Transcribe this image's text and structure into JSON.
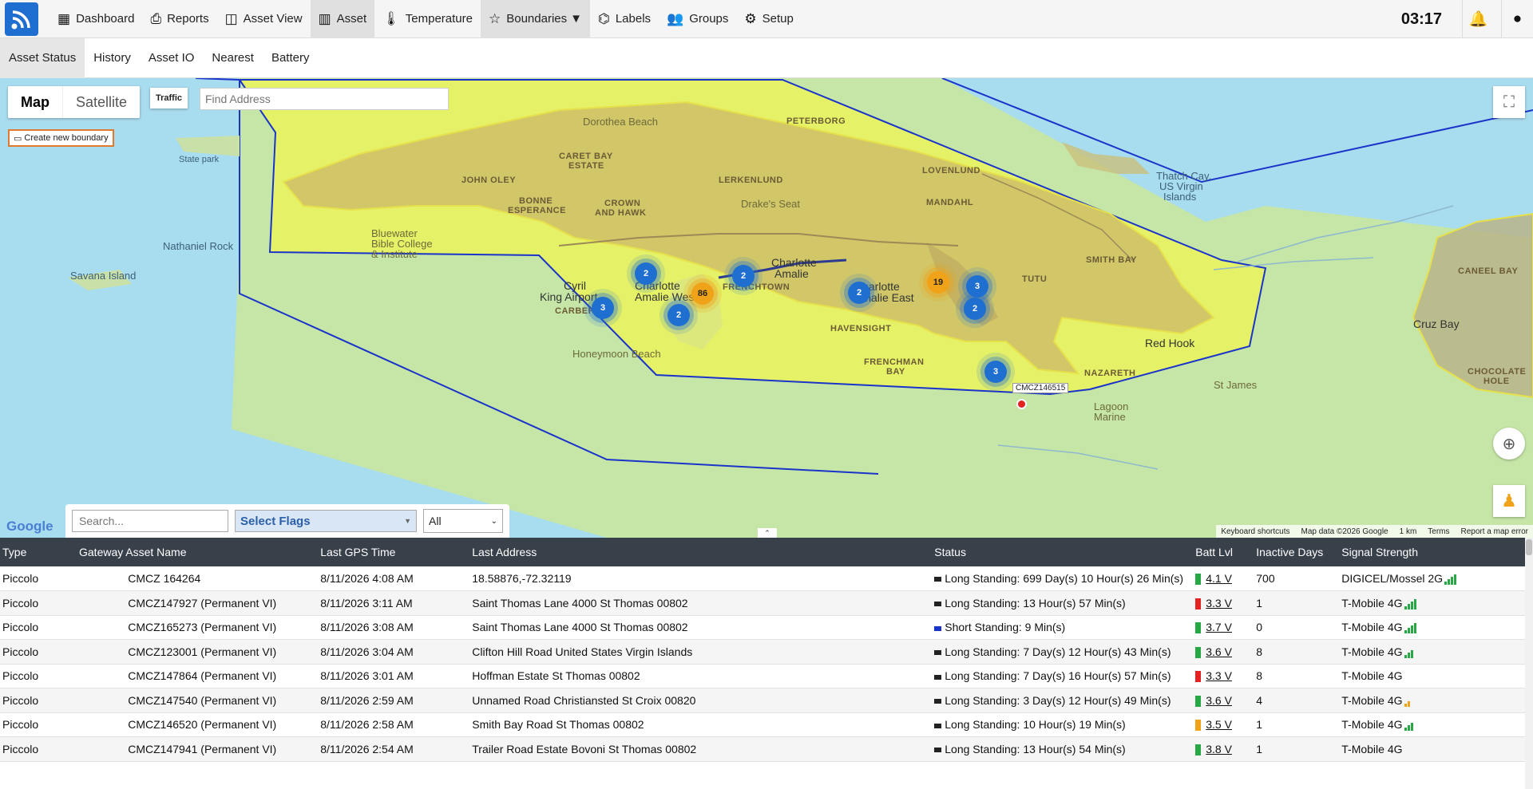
{
  "header": {
    "nav": [
      {
        "label": "Dashboard",
        "icon": "dashboard-icon"
      },
      {
        "label": "Reports",
        "icon": "printer-icon"
      },
      {
        "label": "Asset View",
        "icon": "map-icon"
      },
      {
        "label": "Asset",
        "icon": "barcode-icon"
      },
      {
        "label": "Temperature",
        "icon": "thermometer-icon"
      },
      {
        "label": "Boundaries",
        "icon": "star-icon"
      },
      {
        "label": "Labels",
        "icon": "tag-icon"
      },
      {
        "label": "Groups",
        "icon": "users-icon"
      },
      {
        "label": "Setup",
        "icon": "gear-icon"
      }
    ],
    "clock": "03:17"
  },
  "subnav": {
    "tabs": [
      "Asset Status",
      "History",
      "Asset IO",
      "Nearest",
      "Battery"
    ]
  },
  "map": {
    "type_map": "Map",
    "type_satellite": "Satellite",
    "traffic": "Traffic",
    "find_address_placeholder": "Find Address",
    "create_boundary": "Create new boundary",
    "labels": {
      "dorothea_beach": "Dorothea Beach",
      "peterborg": "PETERBORG",
      "caret_bay": "CARET BAY",
      "estate": "ESTATE",
      "john_oley": "JOHN OLEY",
      "lerkenlund": "LERKENLUND",
      "lovenlund": "LOVENLUND",
      "bonne": "BONNE",
      "esperance": "ESPERANCE",
      "crown": "CROWN",
      "and_hawk": "AND HAWK",
      "drakes_seat": "Drake's Seat",
      "mandahl": "MANDAHL",
      "thatch_cay": "Thatch Cay,",
      "us_virgin": "US Virgin",
      "islands": "Islands",
      "state_park": "State park",
      "nathaniel_rock": "Nathaniel Rock",
      "savana_island": "Savana Island",
      "bluewater": "Bluewater",
      "bible_college": "Bible College",
      "institute": "& Institute",
      "charlotte_amalie": "Charlotte",
      "amalie": "Amalie",
      "charlotte_east": "Charlotte",
      "amalie_east": "Amalie East",
      "cyril": "Cyril",
      "king_airport": "King Airport",
      "charlotte_amalie_west": "Charlotte",
      "amalie_west": "Amalie West",
      "frenchtown": "FRENCHTOWN",
      "havensight": "HAVENSIGHT",
      "smith_bay": "SMITH BAY",
      "tutu": "TUTU",
      "honeymoon_beach": "Honeymoon Beach",
      "frenchman": "FRENCHMAN",
      "bay": "BAY",
      "red_hook": "Red Hook",
      "nazareth": "NAZARETH",
      "james": "St James",
      "marine": "Marine",
      "lagoon": "Lagoon",
      "cruz_bay": "Cruz Bay",
      "caneel_bay": "CANEEL BAY",
      "chocolate_hole": "CHOCOLATE",
      "hole": "HOLE",
      "campbell": "CARBERG",
      "asset_tag": "CMCZ146515"
    },
    "clusters": [
      {
        "label": "2",
        "kind": "blue"
      },
      {
        "label": "86",
        "kind": "orange"
      },
      {
        "label": "2",
        "kind": "blue"
      },
      {
        "label": "3",
        "kind": "blue"
      },
      {
        "label": "2",
        "kind": "blue"
      },
      {
        "label": "2",
        "kind": "blue"
      },
      {
        "label": "19",
        "kind": "orange"
      },
      {
        "label": "3",
        "kind": "blue"
      },
      {
        "label": "2",
        "kind": "blue"
      },
      {
        "label": "3",
        "kind": "blue"
      }
    ],
    "google": "Google",
    "footer": {
      "shortcuts": "Keyboard shortcuts",
      "data": "Map data ©2026 Google",
      "scale": "1 km",
      "terms": "Terms",
      "report": "Report a map error"
    },
    "colors": {
      "water": "#a8dcef",
      "boundary": "#e8f25a",
      "land": "#c9c07a",
      "outline": "#1a33c9",
      "cluster_blue": "#1f6fd1",
      "cluster_orange": "#f0a318"
    }
  },
  "filters": {
    "search_placeholder": "Search...",
    "flags": "Select Flags",
    "all": "All"
  },
  "table": {
    "headers": [
      "Type",
      "Gateway",
      "Asset Name",
      "Last GPS Time",
      "Last Address",
      "Status",
      "Batt Lvl",
      "Inactive Days",
      "Signal Strength"
    ],
    "rows": [
      {
        "type": "Piccolo",
        "gateway": "",
        "name": "CMCZ 164264",
        "time": "8/11/2026 4:08 AM",
        "address": "18.58876,-72.32119",
        "status": "Long Standing: 699 Day(s) 10 Hour(s) 26 Min(s)",
        "status_color": "#222222",
        "batt": "4.1 V",
        "batt_color": "#27a844",
        "inactive": "700",
        "signal": "DIGICEL/Mossel 2G",
        "bars": 4,
        "bars_color": "#27a844"
      },
      {
        "type": "Piccolo",
        "gateway": "",
        "name": "CMCZ147927 (Permanent VI)",
        "time": "8/11/2026 3:11 AM",
        "address": "Saint Thomas Lane 4000 St Thomas 00802",
        "status": "Long Standing: 13 Hour(s) 57 Min(s)",
        "status_color": "#222222",
        "batt": "3.3 V",
        "batt_color": "#e52222",
        "inactive": "1",
        "signal": "T-Mobile 4G",
        "bars": 4,
        "bars_color": "#27a844"
      },
      {
        "type": "Piccolo",
        "gateway": "",
        "name": "CMCZ165273 (Permanent VI)",
        "time": "8/11/2026 3:08 AM",
        "address": "Saint Thomas Lane 4000 St Thomas 00802",
        "status": "Short Standing: 9 Min(s)",
        "status_color": "#1a33c9",
        "batt": "3.7 V",
        "batt_color": "#27a844",
        "inactive": "0",
        "signal": "T-Mobile 4G",
        "bars": 4,
        "bars_color": "#27a844"
      },
      {
        "type": "Piccolo",
        "gateway": "",
        "name": "CMCZ123001 (Permanent VI)",
        "time": "8/11/2026 3:04 AM",
        "address": "Clifton Hill Road United States Virgin Islands",
        "status": "Long Standing: 7 Day(s) 12 Hour(s) 43 Min(s)",
        "status_color": "#222222",
        "batt": "3.6 V",
        "batt_color": "#27a844",
        "inactive": "8",
        "signal": "T-Mobile 4G",
        "bars": 3,
        "bars_color": "#27a844"
      },
      {
        "type": "Piccolo",
        "gateway": "",
        "name": "CMCZ147864 (Permanent VI)",
        "time": "8/11/2026 3:01 AM",
        "address": "Hoffman Estate St Thomas 00802",
        "status": "Long Standing: 7 Day(s) 16 Hour(s) 57 Min(s)",
        "status_color": "#222222",
        "batt": "3.3 V",
        "batt_color": "#e52222",
        "inactive": "8",
        "signal": "T-Mobile 4G",
        "bars": 0,
        "bars_color": "#27a844"
      },
      {
        "type": "Piccolo",
        "gateway": "",
        "name": "CMCZ147540 (Permanent VI)",
        "time": "8/11/2026 2:59 AM",
        "address": "Unnamed Road Christiansted St Croix 00820",
        "status": "Long Standing: 3 Day(s) 12 Hour(s) 49 Min(s)",
        "status_color": "#222222",
        "batt": "3.6 V",
        "batt_color": "#27a844",
        "inactive": "4",
        "signal": "T-Mobile 4G",
        "bars": 2,
        "bars_color": "#f0a318"
      },
      {
        "type": "Piccolo",
        "gateway": "",
        "name": "CMCZ146520 (Permanent VI)",
        "time": "8/11/2026 2:58 AM",
        "address": "Smith Bay Road St Thomas 00802",
        "status": "Long Standing: 10 Hour(s) 19 Min(s)",
        "status_color": "#222222",
        "batt": "3.5 V",
        "batt_color": "#f0a318",
        "inactive": "1",
        "signal": "T-Mobile 4G",
        "bars": 3,
        "bars_color": "#27a844"
      },
      {
        "type": "Piccolo",
        "gateway": "",
        "name": "CMCZ147941 (Permanent VI)",
        "time": "8/11/2026 2:54 AM",
        "address": "Trailer Road Estate Bovoni St Thomas 00802",
        "status": "Long Standing: 13 Hour(s) 54 Min(s)",
        "status_color": "#222222",
        "batt": "3.8 V",
        "batt_color": "#27a844",
        "inactive": "1",
        "signal": "T-Mobile 4G",
        "bars": 0,
        "bars_color": "#27a844"
      }
    ]
  }
}
